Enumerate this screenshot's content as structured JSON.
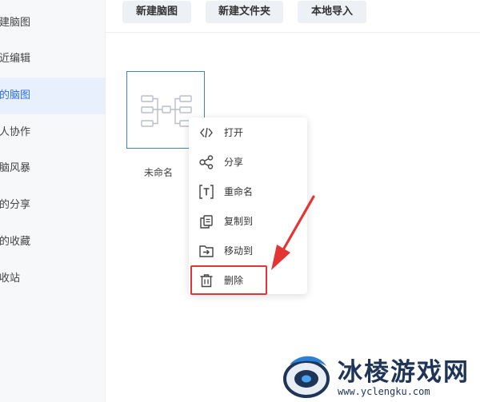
{
  "sidebar": {
    "items": [
      {
        "label": "新建脑图"
      },
      {
        "label": "最近编辑"
      },
      {
        "label": "我的脑图"
      },
      {
        "label": "多人协作"
      },
      {
        "label": "头脑风暴"
      },
      {
        "label": "我的分享"
      },
      {
        "label": "我的收藏"
      },
      {
        "label": "回收站"
      }
    ],
    "active_index": 2
  },
  "toolbar": {
    "new_mindmap_label": "新建脑图",
    "new_folder_label": "新建文件夹",
    "import_label": "本地导入"
  },
  "file": {
    "name": "未命名"
  },
  "context_menu": {
    "items": [
      {
        "label": "打开",
        "icon": "code-brackets-icon"
      },
      {
        "label": "分享",
        "icon": "share-icon"
      },
      {
        "label": "重命名",
        "icon": "rename-icon"
      },
      {
        "label": "复制到",
        "icon": "copy-icon"
      },
      {
        "label": "移动到",
        "icon": "move-folder-icon"
      },
      {
        "label": "删除",
        "icon": "trash-icon"
      }
    ],
    "highlighted_item": "删除"
  },
  "annotation": {
    "color": "#e43535"
  },
  "watermark": {
    "brand_text": "冰棱游戏网",
    "url": "www.yclengku.com"
  }
}
